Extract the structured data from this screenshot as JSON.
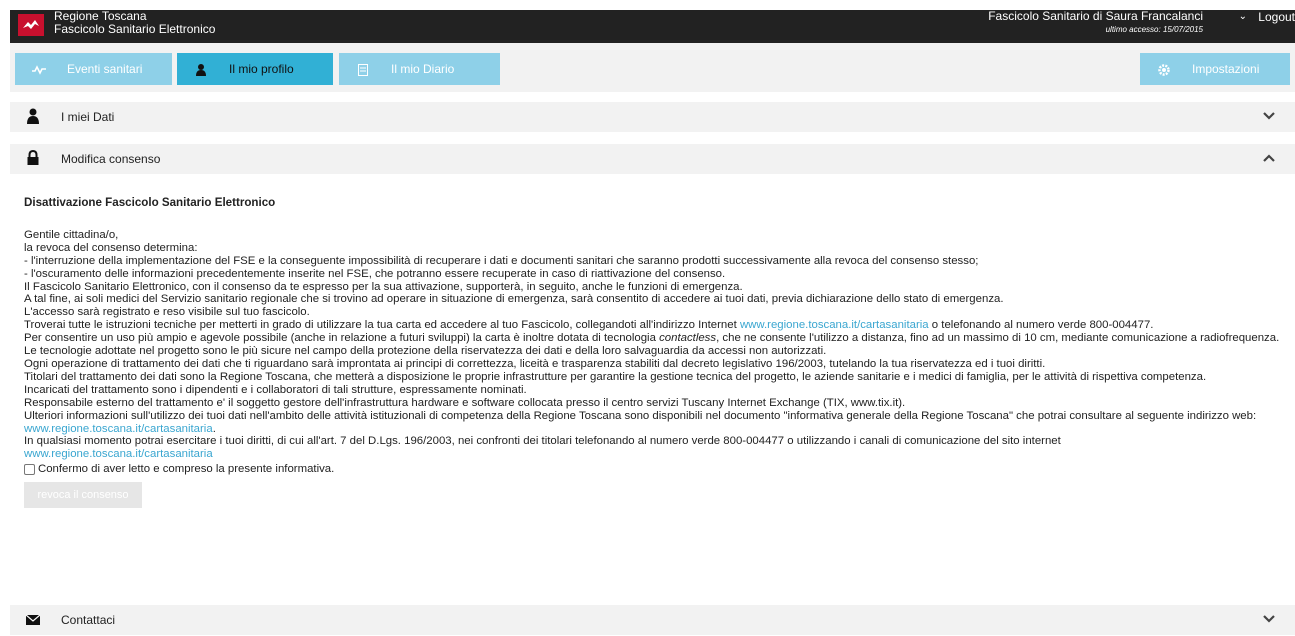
{
  "header": {
    "brand_line1": "Regione Toscana",
    "brand_line2": "Fascicolo Sanitario Elettronico",
    "user_title": "Fascicolo Sanitario di Saura Francalanci",
    "last_access": "ultimo accesso: 15/07/2015",
    "logout": "Logout"
  },
  "nav": {
    "eventi": "Eventi sanitari",
    "profilo": "Il mio profilo",
    "diario": "Il mio Diario",
    "impostazioni": "Impostazioni"
  },
  "sections": {
    "dati": "I miei Dati",
    "consenso": "Modifica consenso",
    "contattaci": "Contattaci"
  },
  "content": {
    "title": "Disattivazione Fascicolo Sanitario Elettronico",
    "p1": "Gentile cittadina/o,",
    "p2": "la revoca del consenso determina:",
    "p3": "- l'interruzione della implementazione del FSE e la conseguente impossibilità di recuperare i dati e documenti sanitari che saranno prodotti successivamente alla revoca del consenso stesso;",
    "p4": "- l'oscuramento delle informazioni precedentemente inserite nel FSE, che potranno essere recuperate in caso di riattivazione del consenso.",
    "p5": "Il Fascicolo Sanitario Elettronico, con il consenso da te espresso per la sua attivazione, supporterà, in seguito, anche le funzioni di emergenza.",
    "p6": "A tal fine, ai soli medici del Servizio sanitario regionale che si trovino ad operare in situazione di emergenza, sarà consentito di accedere ai tuoi dati, previa dichiarazione dello stato di emergenza.",
    "p7": "L'accesso sarà registrato e reso visibile sul tuo fascicolo.",
    "p8a": "Troverai tutte le istruzioni tecniche per metterti in grado di utilizzare la tua carta ed accedere al tuo Fascicolo, collegandoti all'indirizzo Internet ",
    "p8link": "www.regione.toscana.it/cartasanitaria",
    "p8b": " o telefonando al numero verde 800-004477.",
    "p9a": "Per consentire un uso più ampio e agevole possibile (anche in relazione a futuri sviluppi) la carta è inoltre dotata di tecnologia ",
    "p9em": "contactless",
    "p9b": ", che ne consente l'utilizzo a distanza, fino ad un massimo di 10 cm, mediante comunicazione a radiofrequenza.",
    "p10": "Le tecnologie adottate nel progetto sono le più sicure nel campo della protezione della riservatezza dei dati e della loro salvaguardia da accessi non autorizzati.",
    "p11": "Ogni operazione di trattamento dei dati che ti riguardano sarà improntata ai principi di correttezza, liceità e trasparenza stabiliti dal decreto legislativo 196/2003, tutelando la tua riservatezza ed i tuoi diritti.",
    "p12": "Titolari del trattamento dei dati sono la Regione Toscana, che metterà a disposizione le proprie infrastrutture per garantire la gestione tecnica del progetto, le aziende sanitarie e i medici di famiglia, per le attività di rispettiva competenza.",
    "p13": "Incaricati del trattamento sono i dipendenti e i collaboratori di tali strutture, espressamente nominati.",
    "p14": "Responsabile esterno del trattamento e' il soggetto gestore dell'infrastruttura hardware e software collocata presso il centro servizi Tuscany Internet Exchange (TIX, www.tix.it).",
    "p15a": "Ulteriori informazioni sull'utilizzo dei tuoi dati nell'ambito delle attività istituzionali di competenza della Regione Toscana sono disponibili nel documento \"informativa generale della Regione Toscana\" che potrai consultare al seguente indirizzo web: ",
    "p15link": "www.regione.toscana.it/cartasanitaria",
    "p15b": ".",
    "p16": "In qualsiasi momento potrai esercitare i tuoi diritti, di cui all'art. 7 del D.Lgs. 196/2003, nei confronti dei titolari telefonando al numero verde 800-004477 o utilizzando i canali di comunicazione del sito internet",
    "p16link": "www.regione.toscana.it/cartasanitaria",
    "confirm": "Confermo di aver letto e compreso la presente informativa.",
    "revoca": "revoca il consenso"
  },
  "colors": {
    "accent": "#31b0d5",
    "accent_light": "#8ed0e8",
    "topbar": "#222222",
    "link": "#3aa6d0"
  }
}
